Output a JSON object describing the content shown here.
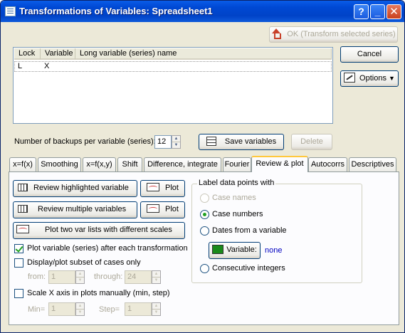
{
  "window": {
    "title": "Transformations of Variables: Spreadsheet1"
  },
  "buttons": {
    "ok": "OK (Transform selected series)",
    "cancel": "Cancel",
    "options": "Options",
    "save_variables": "Save variables",
    "delete": "Delete"
  },
  "variable_list": {
    "columns": [
      "Lock",
      "Variable",
      "Long variable (series) name"
    ],
    "rows": [
      {
        "lock": "L",
        "variable": "X",
        "long_name": ""
      }
    ]
  },
  "backups": {
    "label": "Number of backups per variable (series):",
    "value": "12"
  },
  "tabs": [
    "x=f(x)",
    "Smoothing",
    "x=f(x,y)",
    "Shift",
    "Difference, integrate",
    "Fourier",
    "Review & plot",
    "Autocorrs",
    "Descriptives"
  ],
  "active_tab": "Review & plot",
  "review": {
    "review_highlighted": "Review highlighted variable",
    "review_multiple": "Review multiple variables",
    "plot": "Plot",
    "plot_two_lists": "Plot two var lists with different scales",
    "plot_after_transform": "Plot variable (series) after each transformation",
    "plot_after_transform_checked": true,
    "display_subset": "Display/plot subset of cases only",
    "display_subset_checked": false,
    "from_label": "from:",
    "from_value": "1",
    "through_label": "through:",
    "through_value": "24",
    "scale_x": "Scale X axis in plots manually (min, step)",
    "scale_x_checked": false,
    "min_label": "Min=",
    "min_value": "1",
    "step_label": "Step=",
    "step_value": "1"
  },
  "label_group": {
    "title": "Label data points with",
    "case_names": "Case names",
    "case_numbers": "Case numbers",
    "dates_from_variable": "Dates from a variable",
    "variable_button": "Variable:",
    "variable_value": "none",
    "consecutive_integers": "Consecutive integers",
    "selected": "case_numbers"
  },
  "colors": {
    "title_bar": "#0054e3",
    "dialog_bg": "#ece9d8",
    "active_tab_accent": "#ffc83c",
    "check_mark": "#21a121",
    "link_value": "#0000c0"
  }
}
